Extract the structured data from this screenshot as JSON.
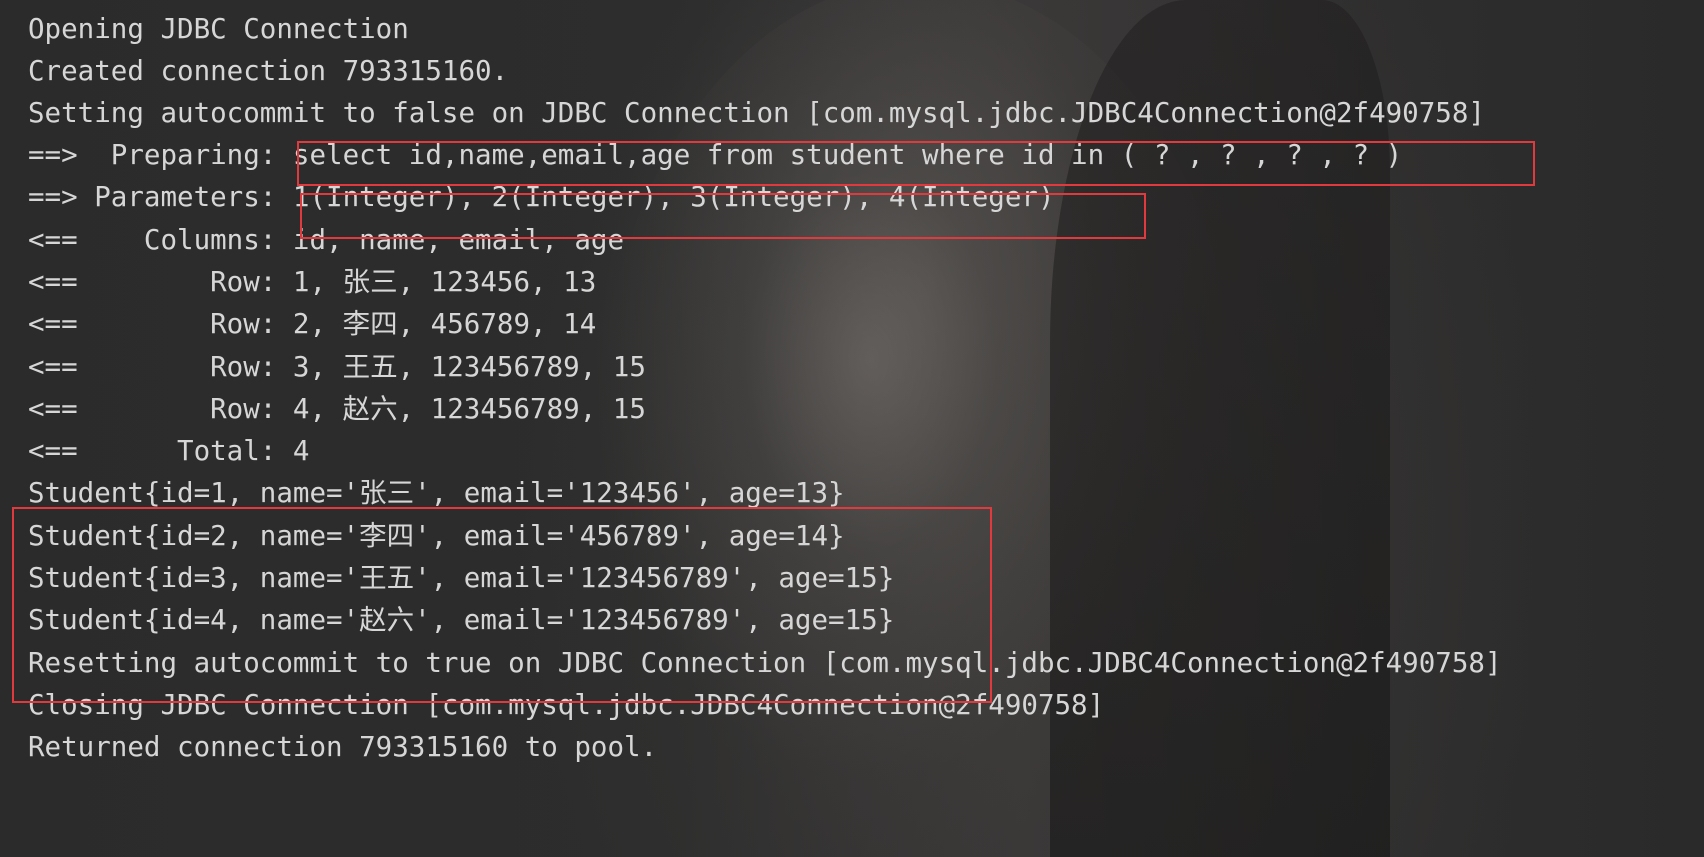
{
  "console": {
    "lines": [
      "Opening JDBC Connection",
      "Created connection 793315160.",
      "Setting autocommit to false on JDBC Connection [com.mysql.jdbc.JDBC4Connection@2f490758]",
      "==>  Preparing: select id,name,email,age from student where id in ( ? , ? , ? , ? )",
      "==> Parameters: 1(Integer), 2(Integer), 3(Integer), 4(Integer)",
      "<==    Columns: id, name, email, age",
      "<==        Row: 1, 张三, 123456, 13",
      "<==        Row: 2, 李四, 456789, 14",
      "<==        Row: 3, 王五, 123456789, 15",
      "<==        Row: 4, 赵六, 123456789, 15",
      "<==      Total: 4",
      "Student{id=1, name='张三', email='123456', age=13}",
      "Student{id=2, name='李四', email='456789', age=14}",
      "Student{id=3, name='王五', email='123456789', age=15}",
      "Student{id=4, name='赵六', email='123456789', age=15}",
      "Resetting autocommit to true on JDBC Connection [com.mysql.jdbc.JDBC4Connection@2f490758]",
      "Closing JDBC Connection [com.mysql.jdbc.JDBC4Connection@2f490758]",
      "Returned connection 793315160 to pool."
    ]
  },
  "colors": {
    "text": "#d6d6d6",
    "highlight_border": "#e0393e",
    "background": "#2b2b2b"
  }
}
